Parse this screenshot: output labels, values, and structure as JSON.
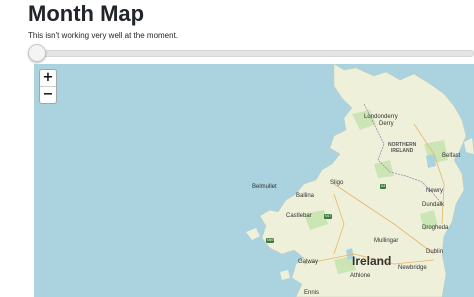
{
  "header": {
    "title": "Month Map",
    "note": "This isn't working very well at the moment."
  },
  "slider": {
    "value": 0
  },
  "map": {
    "zoom_in": "+",
    "zoom_out": "−",
    "labels": {
      "londonderry": "Londonderry",
      "derry": "Derry",
      "northern_ireland_1": "NORTHERN",
      "northern_ireland_2": "IRELAND",
      "belfast": "Belfast",
      "newry": "Newry",
      "dundalk": "Dundalk",
      "belmullet": "Belmullet",
      "ballina": "Ballina",
      "sligo": "Sligo",
      "castlebar": "Castlebar",
      "ireland": "Ireland",
      "mullingar": "Mullingar",
      "drogheda": "Drogheda",
      "galway": "Galway",
      "dublin": "Dublin",
      "newbridge": "Newbridge",
      "athlone": "Athlone",
      "ennis": "Ennis"
    },
    "road_shields": {
      "a4": "A4",
      "n17": "N17",
      "n59": "N59"
    },
    "colors": {
      "sea": "#aad3df",
      "land": "#eef0da",
      "green": "#cbe5b5",
      "border": "#a08aa8"
    }
  }
}
